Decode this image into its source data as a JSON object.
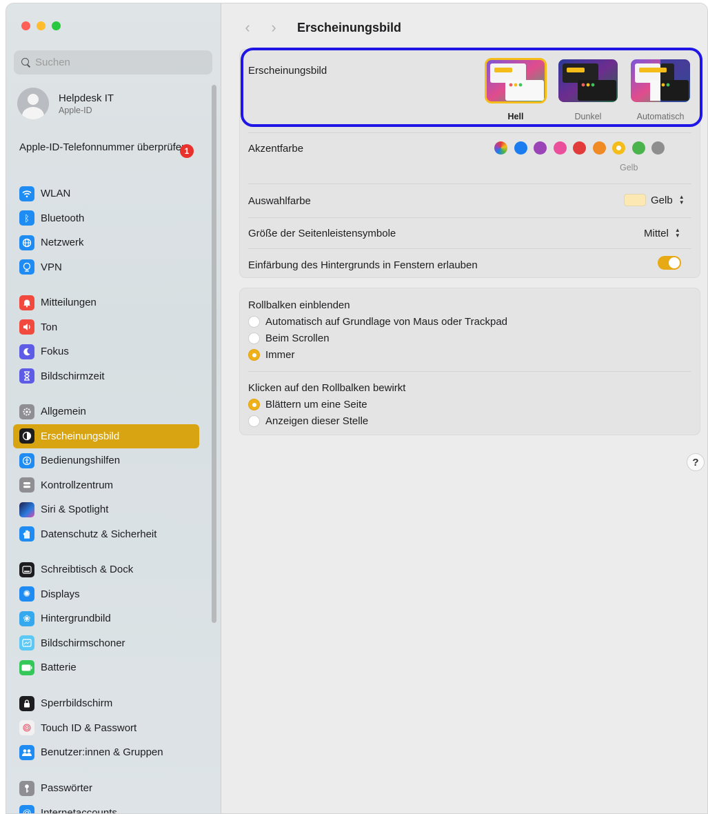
{
  "window": {
    "title": "Erscheinungsbild"
  },
  "sidebar": {
    "search_placeholder": "Suchen",
    "account": {
      "name": "Helpdesk IT",
      "subtitle": "Apple-ID"
    },
    "notice": {
      "text": "Apple-ID-Telefonnummer überprüfen",
      "badge": "1"
    },
    "groups": [
      [
        {
          "label": "WLAN",
          "icon": "wifi-icon",
          "color": "#1e8cf3"
        },
        {
          "label": "Bluetooth",
          "icon": "bluetooth-icon",
          "color": "#1e8cf3"
        },
        {
          "label": "Netzwerk",
          "icon": "globe-icon",
          "color": "#1e8cf3"
        },
        {
          "label": "VPN",
          "icon": "vpn-icon",
          "color": "#1e8cf3"
        }
      ],
      [
        {
          "label": "Mitteilungen",
          "icon": "bell-icon",
          "color": "#f2493f"
        },
        {
          "label": "Ton",
          "icon": "speaker-icon",
          "color": "#f2493f"
        },
        {
          "label": "Fokus",
          "icon": "moon-icon",
          "color": "#5e5ce6"
        },
        {
          "label": "Bildschirmzeit",
          "icon": "hourglass-icon",
          "color": "#5e5ce6"
        }
      ],
      [
        {
          "label": "Allgemein",
          "icon": "gear-icon",
          "color": "#8e8e93"
        },
        {
          "label": "Erscheinungsbild",
          "icon": "appearance-icon",
          "color": "#1d1d1f",
          "active": true
        },
        {
          "label": "Bedienungshilfen",
          "icon": "accessibility-icon",
          "color": "#1e8cf3"
        },
        {
          "label": "Kontrollzentrum",
          "icon": "control-center-icon",
          "color": "#8e8e93"
        },
        {
          "label": "Siri & Spotlight",
          "icon": "siri-icon",
          "color": "#2b2f7a"
        },
        {
          "label": "Datenschutz & Sicherheit",
          "icon": "hand-icon",
          "color": "#1e8cf3"
        }
      ],
      [
        {
          "label": "Schreibtisch & Dock",
          "icon": "dock-icon",
          "color": "#1d1d1f"
        },
        {
          "label": "Displays",
          "icon": "sun-icon",
          "color": "#1e8cf3"
        },
        {
          "label": "Hintergrundbild",
          "icon": "flower-icon",
          "color": "#35a9f0"
        },
        {
          "label": "Bildschirmschoner",
          "icon": "screensaver-icon",
          "color": "#5cc8f5"
        },
        {
          "label": "Batterie",
          "icon": "battery-icon",
          "color": "#34c759"
        }
      ],
      [
        {
          "label": "Sperrbildschirm",
          "icon": "lock-icon",
          "color": "#1d1d1f"
        },
        {
          "label": "Touch ID & Passwort",
          "icon": "fingerprint-icon",
          "color": "#f1f1f1"
        },
        {
          "label": "Benutzer:innen & Gruppen",
          "icon": "users-icon",
          "color": "#1e8cf3"
        }
      ],
      [
        {
          "label": "Passwörter",
          "icon": "key-icon",
          "color": "#8e8e93"
        },
        {
          "label": "Internetaccounts",
          "icon": "at-icon",
          "color": "#1e8cf3"
        }
      ]
    ]
  },
  "main": {
    "title": "Erscheinungsbild",
    "appearance": {
      "label": "Erscheinungsbild",
      "options": [
        {
          "label": "Hell",
          "selected": true
        },
        {
          "label": "Dunkel",
          "selected": false
        },
        {
          "label": "Automatisch",
          "selected": false
        }
      ]
    },
    "accent": {
      "label": "Akzentfarbe",
      "selected_name": "Gelb",
      "colors": [
        "multicolor",
        "#1b7cf0",
        "#9a44b8",
        "#ea4f9b",
        "#e23b3b",
        "#f08a24",
        "#f5bd1a",
        "#4bb34b",
        "#8e8e8e"
      ]
    },
    "selection_color": {
      "label": "Auswahlfarbe",
      "value": "Gelb"
    },
    "sidebar_icon_size": {
      "label": "Größe der Seitenleistensymbole",
      "value": "Mittel"
    },
    "tinting": {
      "label": "Einfärbung des Hintergrunds in Fenstern erlauben",
      "on": true
    },
    "scrollbars": {
      "label": "Rollbalken einblenden",
      "options": [
        {
          "label": "Automatisch auf Grundlage von Maus oder Trackpad",
          "selected": false
        },
        {
          "label": "Beim Scrollen",
          "selected": false
        },
        {
          "label": "Immer",
          "selected": true
        }
      ]
    },
    "click_scrollbar": {
      "label": "Klicken auf den Rollbalken bewirkt",
      "options": [
        {
          "label": "Blättern um eine Seite",
          "selected": true
        },
        {
          "label": "Anzeigen dieser Stelle",
          "selected": false
        }
      ]
    },
    "help": "?"
  }
}
